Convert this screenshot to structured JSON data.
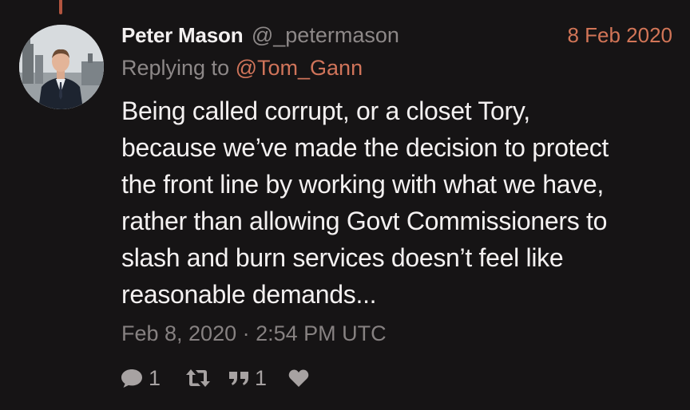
{
  "tweet": {
    "author": {
      "display_name": "Peter Mason",
      "handle": "@_petermason"
    },
    "date_short": "8 Feb 2020",
    "replying_to_prefix": "Replying to",
    "replying_to_handle": "@Tom_Gann",
    "text_lines": [
      "Being called corrupt, or a closet Tory,",
      "because we’ve made the decision to protect",
      "the front line by working with what we have,",
      "rather than allowing Govt Commissioners to",
      "slash and burn services doesn’t feel like",
      "reasonable demands..."
    ],
    "timestamp": "Feb 8, 2020 · 2:54 PM UTC",
    "stats": {
      "replies": "1",
      "quotes": "1"
    }
  },
  "icons": {
    "reply": "comment-icon",
    "retweet": "retweet-icon",
    "quote": "quote-icon",
    "like": "heart-icon"
  },
  "colors": {
    "background": "#161415",
    "accent": "#d0745a",
    "text": "#f4f1f1",
    "muted": "#8d8888"
  }
}
